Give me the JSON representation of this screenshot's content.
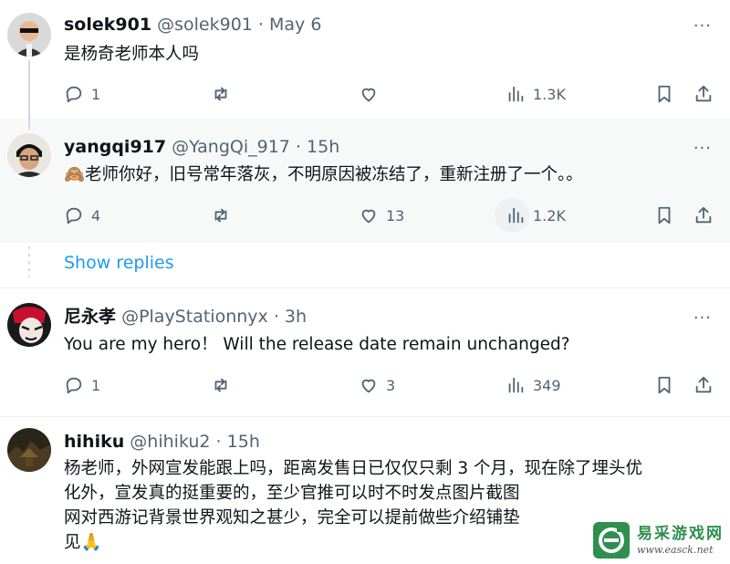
{
  "tweets": [
    {
      "name": "solek901",
      "handle": "@solek901",
      "separator": "·",
      "time": "May 6",
      "text": "是杨奇老师本人吗",
      "replies": "1",
      "retweets": "",
      "likes": "",
      "views": "1.3K"
    },
    {
      "name": "yangqi917",
      "handle": "@YangQi_917",
      "separator": "·",
      "time": "15h",
      "text": "🙈老师你好，旧号常年落灰，不明原因被冻结了，重新注册了一个。。",
      "replies": "4",
      "retweets": "",
      "likes": "13",
      "views": "1.2K"
    },
    {
      "name": "尼永孝",
      "handle": "@PlayStationnyx",
      "separator": "·",
      "time": "3h",
      "text": "You are my hero！ Will the release date remain unchanged?",
      "replies": "1",
      "retweets": "",
      "likes": "3",
      "views": "349"
    },
    {
      "name": "hihiku",
      "handle": "@hihiku2",
      "separator": "·",
      "time": "15h",
      "text_lines": [
        "杨老师，外网宣发能跟上吗，距离发售日已仅仅只剩 3 个月，现在除了埋头优",
        "化外，宣发真的挺重要的，至少官推可以时不时发点图片截图",
        "网对西游记背景世界观知之甚少，完全可以提前做些介绍铺垫",
        "见🙏"
      ]
    }
  ],
  "show_replies": "Show replies",
  "more_glyph": "···",
  "watermark": {
    "title": "易采游戏网",
    "url": "www.easck.net"
  },
  "colors": {
    "accent": "#1d9bf0",
    "text": "#0f1419",
    "muted": "#536471",
    "divider": "#eff3f4",
    "watermark_green": "#2f8f4e"
  }
}
